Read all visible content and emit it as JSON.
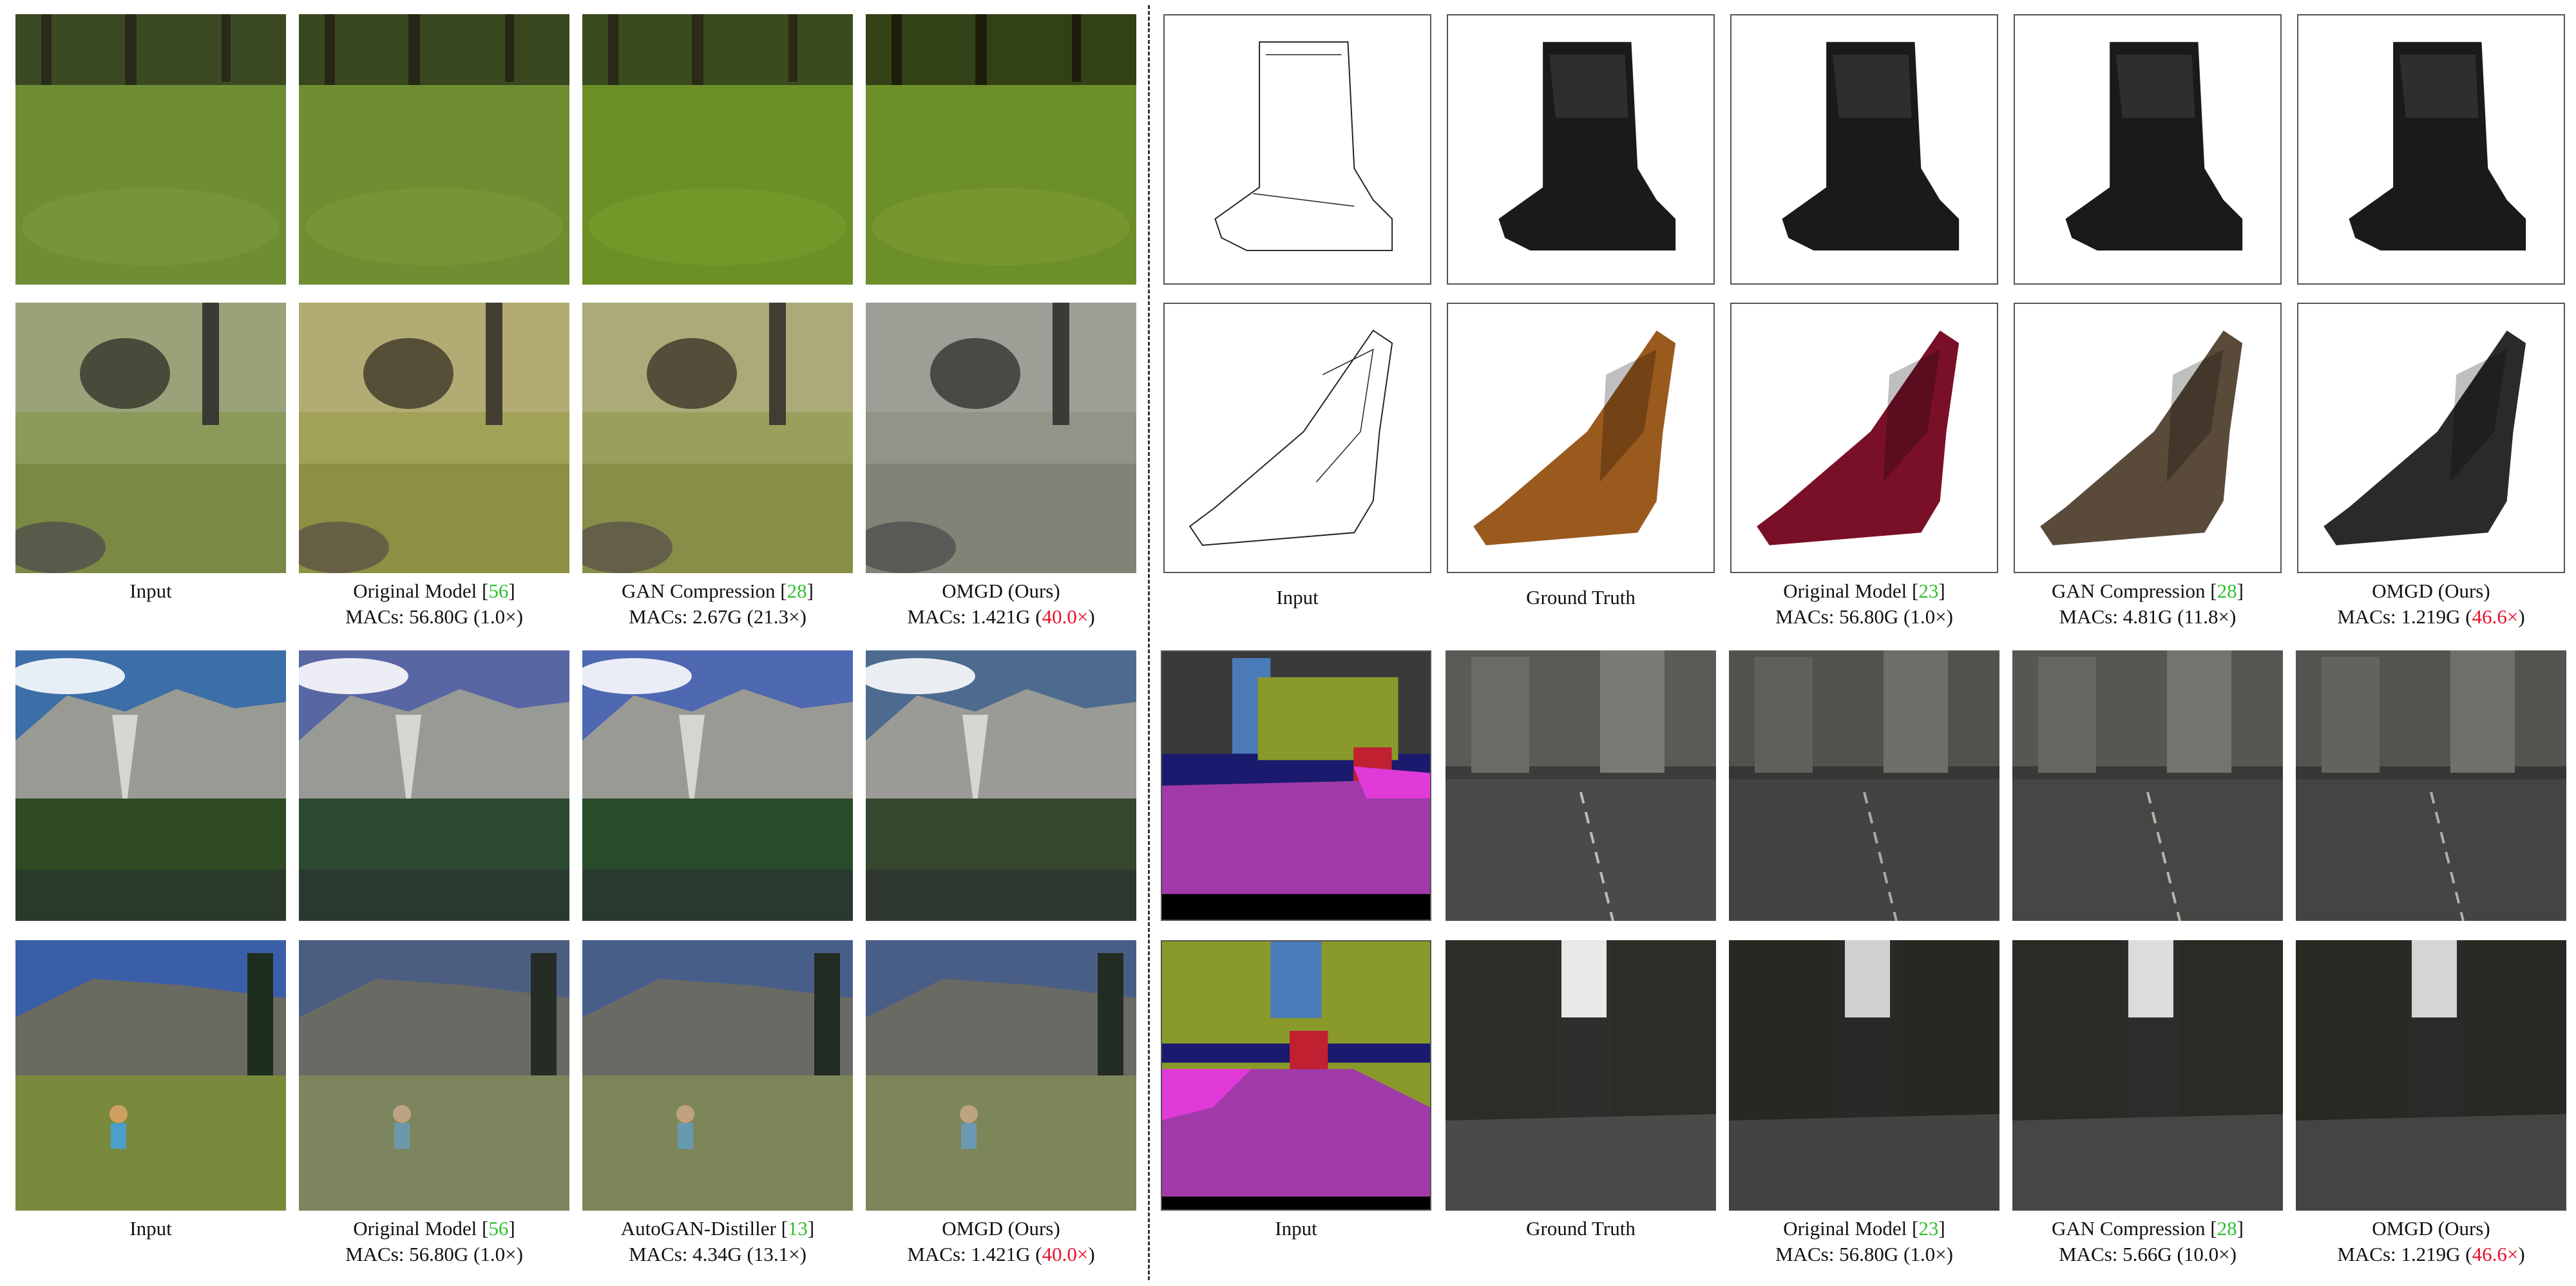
{
  "colors": {
    "citation": "#2fbf2f",
    "highlight": "#e8102c"
  },
  "left_group_1": {
    "row1": {
      "panels": [
        "horses-input",
        "zebra-original",
        "zebra-gancompression",
        "zebra-omgd"
      ]
    },
    "row2": {
      "panels": [
        "horses-input",
        "zebra-original",
        "zebra-gancompression",
        "zebra-omgd"
      ]
    },
    "captions": [
      {
        "label": "Input",
        "macs": ""
      },
      {
        "label": "Original Model [",
        "ref": "56",
        "label_end": "]",
        "macs_prefix": "MACs: 56.80G (1.0×)"
      },
      {
        "label": "GAN Compression [",
        "ref": "28",
        "label_end": "]",
        "macs_prefix": "MACs: 2.67G (21.3×)"
      },
      {
        "label": "OMGD (Ours)",
        "macs_prefix": "MACs: 1.421G (",
        "macs_highlight": "40.0×",
        "macs_suffix": ")"
      }
    ]
  },
  "left_group_2": {
    "captions": [
      {
        "label": "Input",
        "macs": ""
      },
      {
        "label": "Original Model [",
        "ref": "56",
        "label_end": "]",
        "macs_prefix": "MACs: 56.80G (1.0×)"
      },
      {
        "label": "AutoGAN-Distiller [",
        "ref": "13",
        "label_end": "]",
        "macs_prefix": "MACs: 4.34G (13.1×)"
      },
      {
        "label": "OMGD (Ours)",
        "macs_prefix": "MACs: 1.421G (",
        "macs_highlight": "40.0×",
        "macs_suffix": ")"
      }
    ]
  },
  "right_group_1": {
    "captions": [
      {
        "label": "Input",
        "macs": ""
      },
      {
        "label": "Ground Truth",
        "macs": ""
      },
      {
        "label": "Original Model [",
        "ref": "23",
        "label_end": "]",
        "macs_prefix": "MACs: 56.80G (1.0×)"
      },
      {
        "label": "GAN Compression [",
        "ref": "28",
        "label_end": "]",
        "macs_prefix": "MACs: 4.81G (11.8×)"
      },
      {
        "label": "OMGD (Ours)",
        "macs_prefix": "MACs: 1.219G (",
        "macs_highlight": "46.6×",
        "macs_suffix": ")"
      }
    ]
  },
  "right_group_2": {
    "captions": [
      {
        "label": "Input",
        "macs": ""
      },
      {
        "label": "Ground Truth",
        "macs": ""
      },
      {
        "label": "Original Model [",
        "ref": "23",
        "label_end": "]",
        "macs_prefix": "MACs: 56.80G (1.0×)"
      },
      {
        "label": "GAN Compression [",
        "ref": "28",
        "label_end": "]",
        "macs_prefix": "MACs: 5.66G (10.0×)"
      },
      {
        "label": "OMGD (Ours)",
        "macs_prefix": "MACs: 1.219G (",
        "macs_highlight": "46.6×",
        "macs_suffix": ")"
      }
    ]
  }
}
